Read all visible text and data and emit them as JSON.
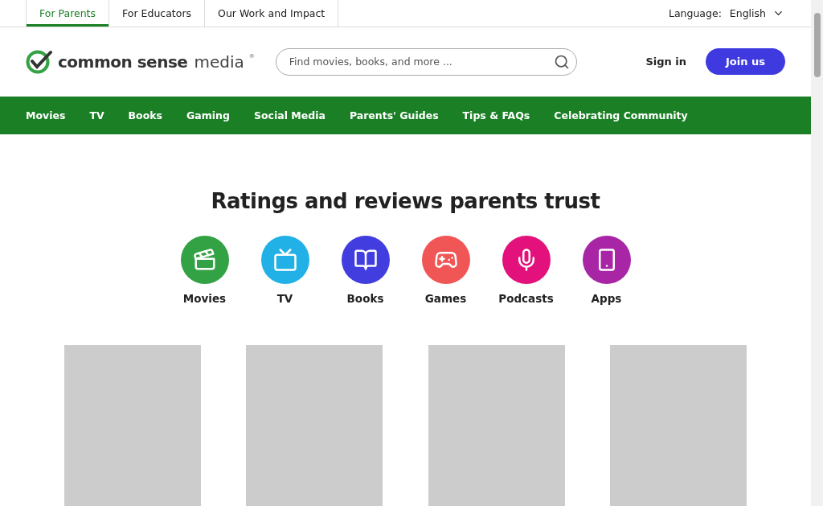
{
  "audience_tabs": [
    {
      "label": "For Parents",
      "selected": true
    },
    {
      "label": "For Educators",
      "selected": false
    },
    {
      "label": "Our Work and Impact",
      "selected": false
    }
  ],
  "language": {
    "label": "Language:",
    "value": "English"
  },
  "logo": {
    "main": "common sense",
    "sub": "media",
    "mark": "®"
  },
  "search": {
    "placeholder": "Find movies, books, and more ..."
  },
  "sign_in": "Sign in",
  "join": "Join us",
  "nav": [
    "Movies",
    "TV",
    "Books",
    "Gaming",
    "Social Media",
    "Parents' Guides",
    "Tips & FAQs",
    "Celebrating Community"
  ],
  "heading": "Ratings and reviews parents trust",
  "categories": [
    {
      "kind": "movies",
      "label": "Movies",
      "color": "#33a244"
    },
    {
      "kind": "tv",
      "label": "TV",
      "color": "#22b1e6"
    },
    {
      "kind": "books",
      "label": "Books",
      "color": "#413ddf"
    },
    {
      "kind": "games",
      "label": "Games",
      "color": "#f15656"
    },
    {
      "kind": "podcasts",
      "label": "Podcasts",
      "color": "#e3117b"
    },
    {
      "kind": "apps",
      "label": "Apps",
      "color": "#a826a6"
    }
  ],
  "placeholders": [
    {
      "kind": "placeholder"
    },
    {
      "kind": "placeholder"
    },
    {
      "kind": "placeholder"
    },
    {
      "kind": "placeholder"
    }
  ]
}
